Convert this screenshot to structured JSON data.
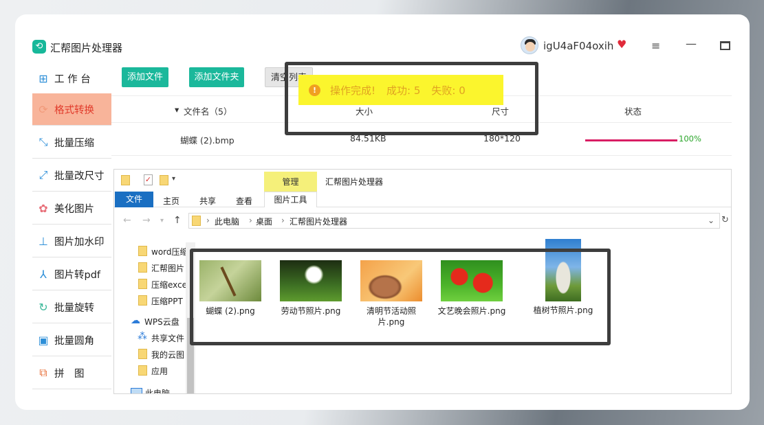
{
  "app": {
    "title": "汇帮图片处理器",
    "username": "igU4aF04oxih"
  },
  "sidebar": {
    "items": [
      {
        "label": "工 作 台",
        "icon": "grid-icon"
      },
      {
        "label": "格式转换",
        "icon": "convert-icon"
      },
      {
        "label": "批量压缩",
        "icon": "compress-icon"
      },
      {
        "label": "批量改尺寸",
        "icon": "resize-icon"
      },
      {
        "label": "美化图片",
        "icon": "beautify-icon"
      },
      {
        "label": "图片加水印",
        "icon": "watermark-icon"
      },
      {
        "label": "图片转pdf",
        "icon": "pdf-icon"
      },
      {
        "label": "批量旋转",
        "icon": "rotate-icon"
      },
      {
        "label": "批量圆角",
        "icon": "round-corner-icon"
      },
      {
        "label": "拼　图",
        "icon": "puzzle-icon"
      }
    ],
    "active_index": 1
  },
  "toolbar": {
    "add_file": "添加文件",
    "add_folder": "添加文件夹",
    "clear_list": "清空列表"
  },
  "table": {
    "headers": {
      "filename": "文件名（5）",
      "size": "大小",
      "dimensions": "尺寸",
      "status": "状态"
    },
    "rows": [
      {
        "filename": "蝴蝶 (2).bmp",
        "size": "84.51KB",
        "dimensions": "180*120",
        "progress_percent": 100,
        "progress_label": "100%"
      }
    ]
  },
  "toast": {
    "message": "操作完成!",
    "success_label": "成功: 5",
    "fail_label": "失败: 0"
  },
  "explorer": {
    "title": "汇帮图片处理器",
    "context_tab": "管理",
    "ribbon_tabs": [
      "文件",
      "主页",
      "共享",
      "查看",
      "图片工具"
    ],
    "path": [
      "此电脑",
      "桌面",
      "汇帮图片处理器"
    ],
    "nav_items": [
      "word压缩",
      "汇帮图片",
      "压缩excel",
      "压缩PPT",
      "WPS云盘",
      "共享文件",
      "我的云图",
      "应用",
      "此电脑"
    ],
    "files": [
      {
        "name": "蝴蝶 (2).png"
      },
      {
        "name": "劳动节照片.png"
      },
      {
        "name": "清明节活动照片.png"
      },
      {
        "name": "文艺晚会照片.png"
      },
      {
        "name": "植树节照片.png"
      }
    ]
  },
  "colors": {
    "accent": "#1bb89b",
    "active_bg": "#f8b49a",
    "active_text": "#e13a2a",
    "progress": "#d91d63",
    "toast_bg": "#fbf52d"
  }
}
